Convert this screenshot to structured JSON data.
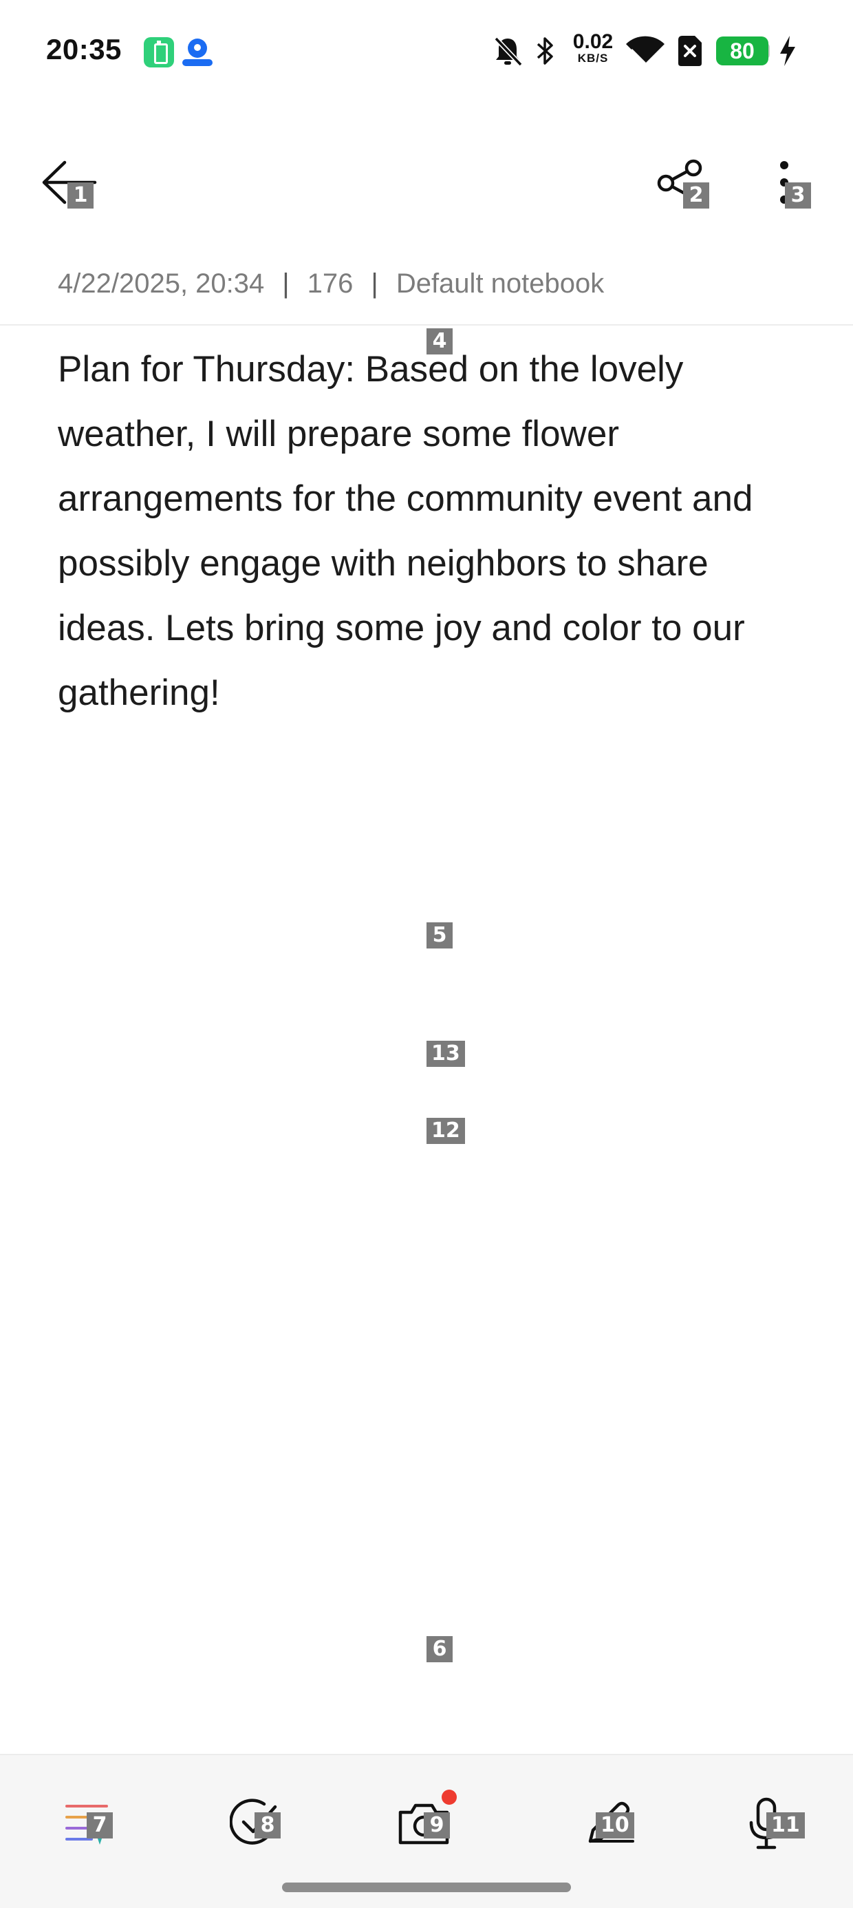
{
  "status_bar": {
    "time": "20:35",
    "net_speed": "0.02",
    "net_unit": "KB/S",
    "battery": "80",
    "icons": [
      "battery-saver-app-icon",
      "location-app-icon",
      "mute-bell-icon",
      "bluetooth-icon",
      "wifi-icon",
      "sim-blocked-icon",
      "charging-icon"
    ]
  },
  "toolbar": {
    "back_icon": "back-arrow-icon",
    "share_icon": "share-icon",
    "more_icon": "more-vertical-icon"
  },
  "meta": {
    "date": "4/22/2025, 20:34",
    "sep1": "|",
    "count": "176",
    "sep2": "|",
    "notebook": "Default notebook"
  },
  "note": {
    "text": "Plan for Thursday: Based on the lovely weather, I will prepare some flower arrangements for the community event and possibly engage with neighbors to share ideas. Lets bring some joy and color to our gathering!"
  },
  "bottom_bar": {
    "items": [
      "text-format-icon",
      "checklist-icon",
      "camera-icon",
      "pen-icon",
      "microphone-icon"
    ],
    "accent": "#ee3b30"
  },
  "marks": {
    "m1": "1",
    "m2": "2",
    "m3": "3",
    "m4": "4",
    "m5": "5",
    "m6": "6",
    "m7": "7",
    "m8": "8",
    "m9": "9",
    "m10": "10",
    "m11": "11",
    "m12": "12",
    "m13": "13"
  }
}
